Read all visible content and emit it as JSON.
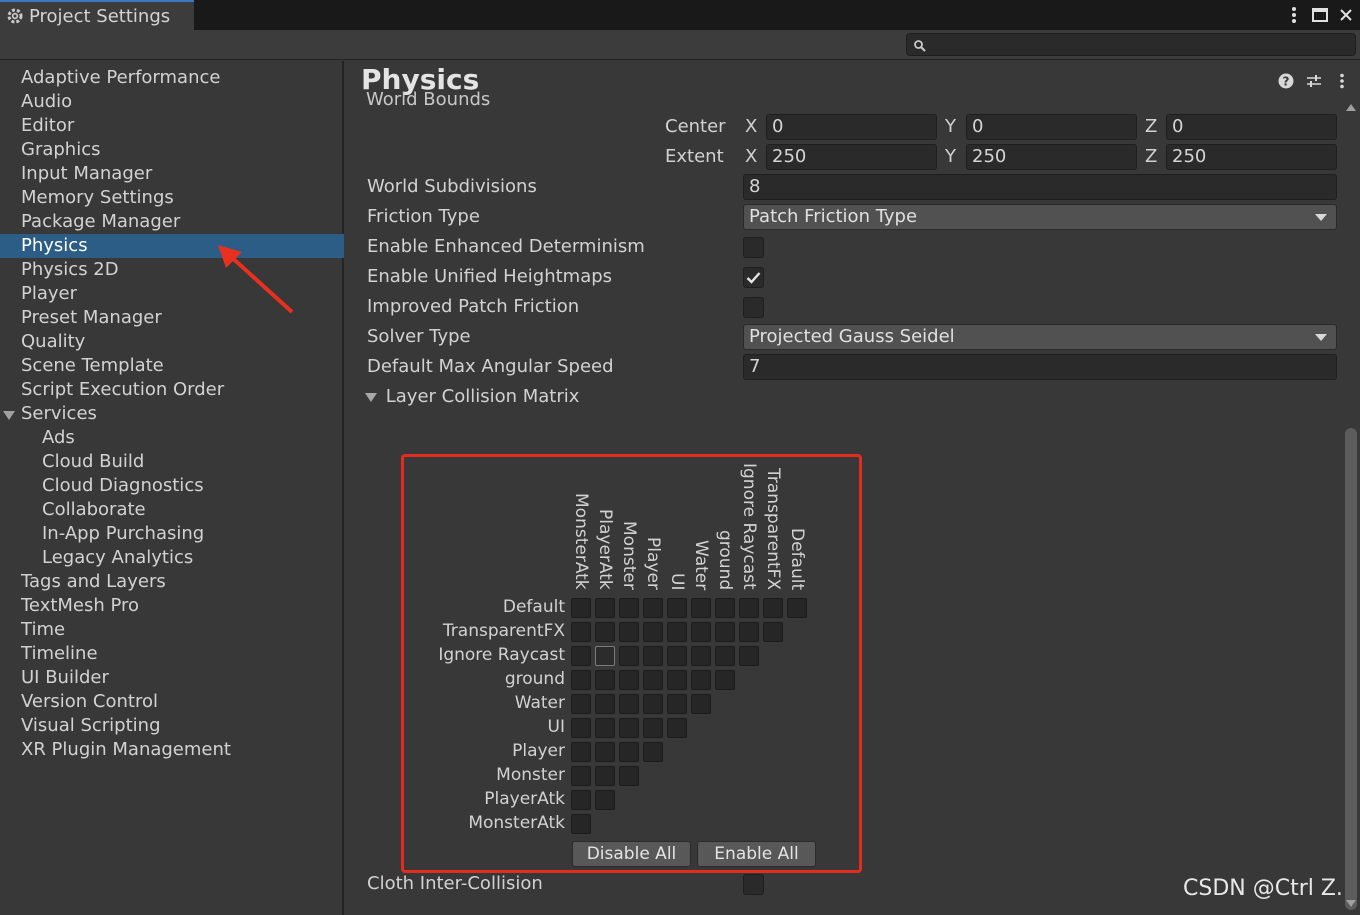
{
  "window": {
    "tab_title": "Project Settings"
  },
  "sidebar": {
    "items": [
      {
        "label": "Adaptive Performance"
      },
      {
        "label": "Audio"
      },
      {
        "label": "Editor"
      },
      {
        "label": "Graphics"
      },
      {
        "label": "Input Manager"
      },
      {
        "label": "Memory Settings"
      },
      {
        "label": "Package Manager"
      },
      {
        "label": "Physics"
      },
      {
        "label": "Physics 2D"
      },
      {
        "label": "Player"
      },
      {
        "label": "Preset Manager"
      },
      {
        "label": "Quality"
      },
      {
        "label": "Scene Template"
      },
      {
        "label": "Script Execution Order"
      },
      {
        "label": "Services"
      },
      {
        "label": "Ads"
      },
      {
        "label": "Cloud Build"
      },
      {
        "label": "Cloud Diagnostics"
      },
      {
        "label": "Collaborate"
      },
      {
        "label": "In-App Purchasing"
      },
      {
        "label": "Legacy Analytics"
      },
      {
        "label": "Tags and Layers"
      },
      {
        "label": "TextMesh Pro"
      },
      {
        "label": "Time"
      },
      {
        "label": "Timeline"
      },
      {
        "label": "UI Builder"
      },
      {
        "label": "Version Control"
      },
      {
        "label": "Visual Scripting"
      },
      {
        "label": "XR Plugin Management"
      }
    ],
    "selected": "Physics"
  },
  "main": {
    "title": "Physics",
    "cut_section_label": "World Bounds",
    "center": {
      "label": "Center",
      "x_label": "X",
      "y_label": "Y",
      "z_label": "Z",
      "x": "0",
      "y": "0",
      "z": "0"
    },
    "extent": {
      "label": "Extent",
      "x_label": "X",
      "y_label": "Y",
      "z_label": "Z",
      "x": "250",
      "y": "250",
      "z": "250"
    },
    "world_subdivisions": {
      "label": "World Subdivisions",
      "value": "8"
    },
    "friction_type": {
      "label": "Friction Type",
      "value": "Patch Friction Type"
    },
    "enhanced_determinism": {
      "label": "Enable Enhanced Determinism",
      "checked": false
    },
    "unified_heightmaps": {
      "label": "Enable Unified Heightmaps",
      "checked": true
    },
    "improved_patch_friction": {
      "label": "Improved Patch Friction",
      "checked": false
    },
    "solver_type": {
      "label": "Solver Type",
      "value": "Projected Gauss Seidel"
    },
    "max_angular_speed": {
      "label": "Default Max Angular Speed",
      "value": "7"
    },
    "layer_collision_matrix": {
      "label": "Layer Collision Matrix",
      "layers": [
        "Default",
        "TransparentFX",
        "Ignore Raycast",
        "ground",
        "Water",
        "UI",
        "Player",
        "Monster",
        "PlayerAtk",
        "MonsterAtk"
      ],
      "disable_all": "Disable All",
      "enable_all": "Enable All"
    },
    "cloth_inter_collision": {
      "label": "Cloth Inter-Collision",
      "checked": false
    }
  },
  "watermark": "CSDN @Ctrl Z."
}
